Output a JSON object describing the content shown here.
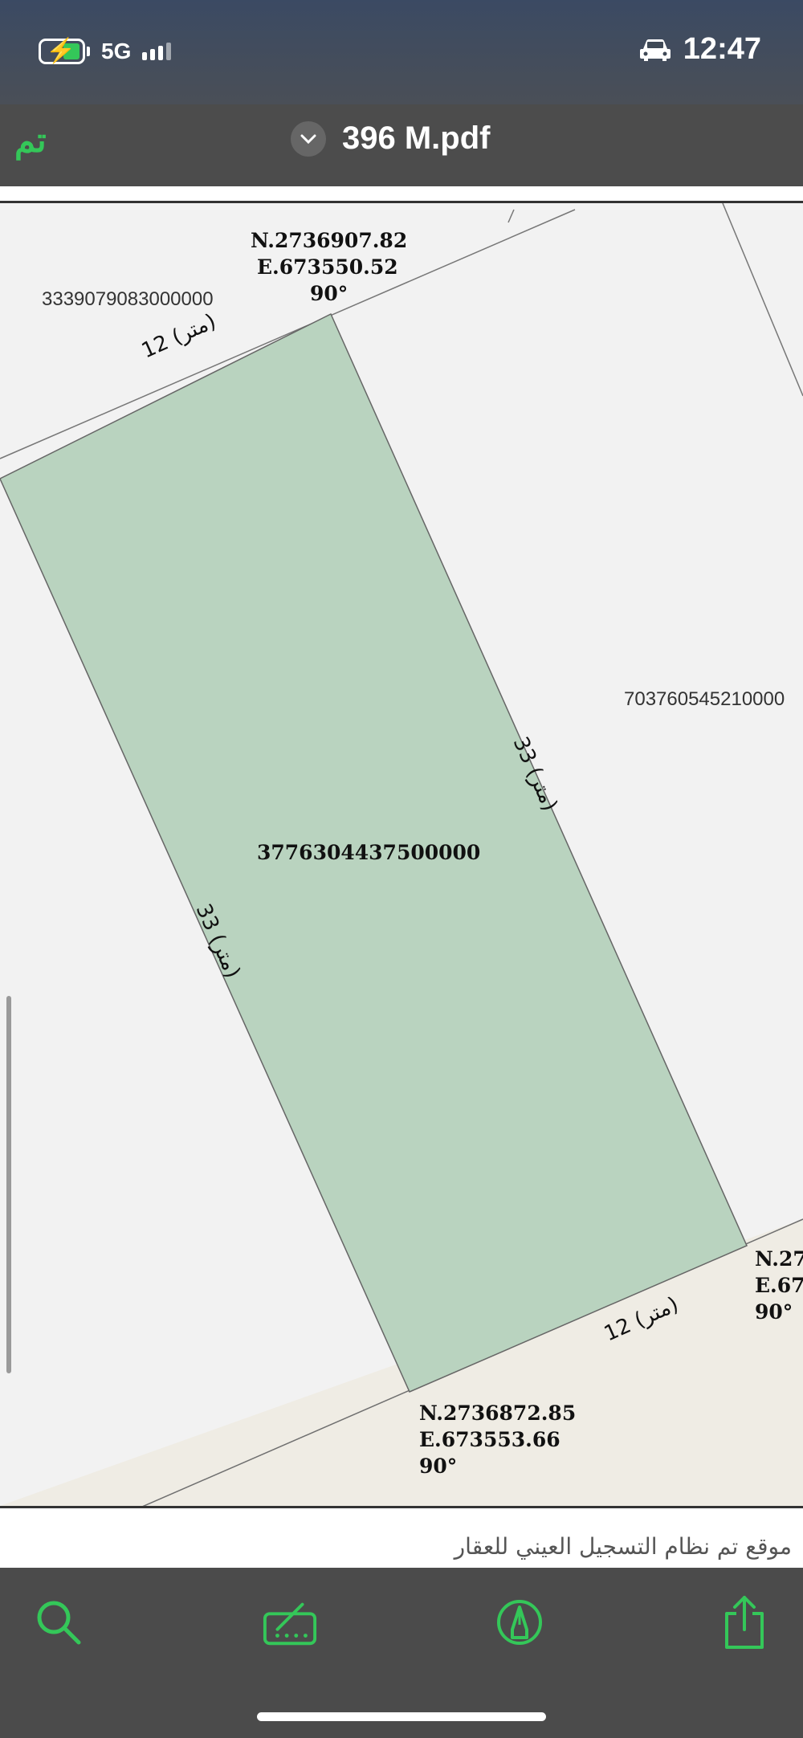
{
  "status": {
    "network": "5G",
    "time": "12:47",
    "battery_icon": "battery-charging-icon",
    "car_icon": "car-icon"
  },
  "nav": {
    "done_label": "تم",
    "title": "396 M.pdf",
    "chevron_icon": "chevron-down-icon"
  },
  "plot": {
    "parcel_id": "3776304437500000",
    "top_left_parcel": "3339079083000000",
    "right_parcel": "703760545210000",
    "top_corner": {
      "north": "N.2736907.82",
      "east": "E.673550.52",
      "angle": "90°"
    },
    "bottom_corner": {
      "north": "N.2736872.85",
      "east": "E.673553.66",
      "angle": "90°"
    },
    "right_corner": {
      "north": "N.27",
      "east": "E.67",
      "angle": "90°"
    },
    "top_side": "12 (متر)",
    "bottom_side": "12 (متر)",
    "left_side": "33 (متر)",
    "right_side": "33 (متر)",
    "colors": {
      "parcel_fill": "#b9d3bf",
      "road_fill": "#efece4",
      "sheet_bg": "#f2f2f2"
    }
  },
  "strip": {
    "text": "موقع تم نظام التسجيل العيني للعقار"
  },
  "toolbar": {
    "search_icon": "search-icon",
    "markup_icon": "markup-icon",
    "annotate_icon": "pen-circle-icon",
    "share_icon": "share-icon",
    "accent": "#34c759"
  }
}
